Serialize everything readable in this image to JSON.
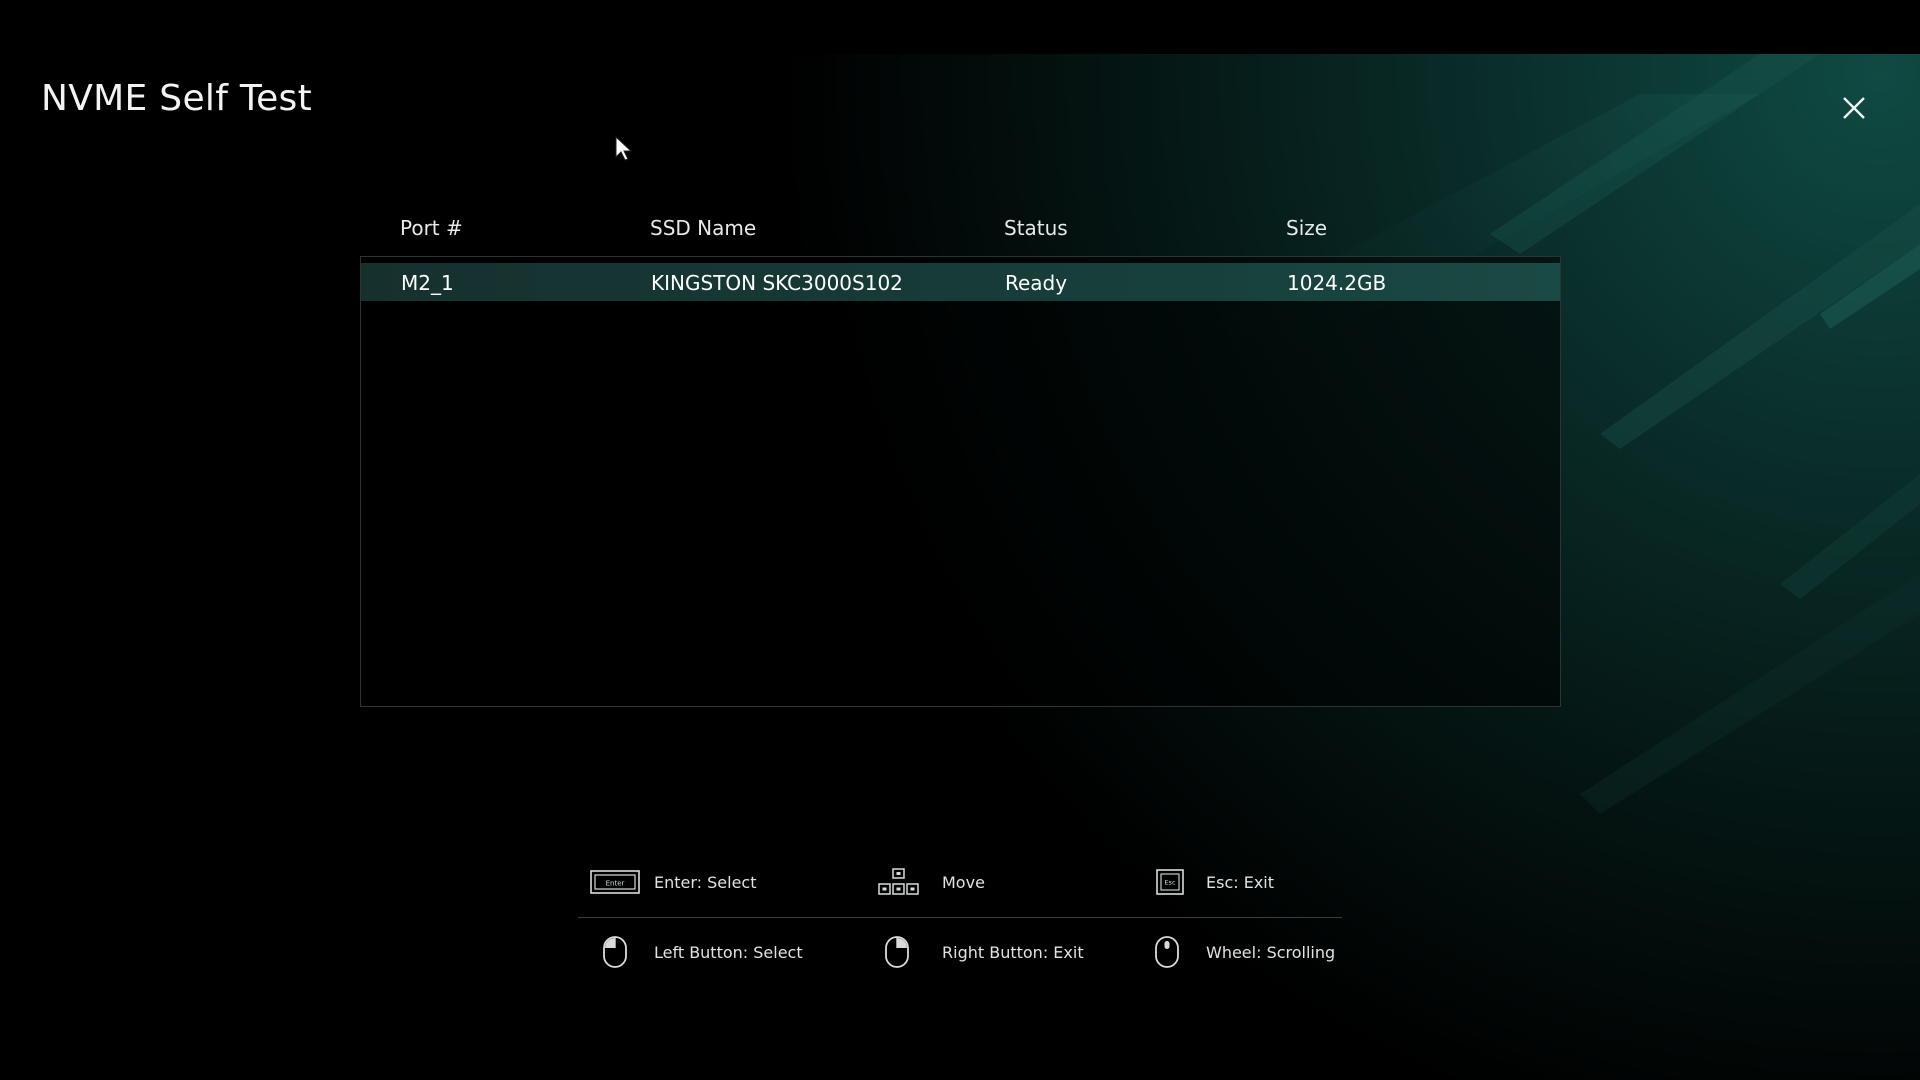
{
  "window": {
    "title": "NVME Self Test",
    "close_icon": "close-icon"
  },
  "table": {
    "columns": [
      "Port #",
      "SSD Name",
      "Status",
      "Size"
    ],
    "rows": [
      {
        "port": "M2_1",
        "name": "KINGSTON SKC3000S102",
        "status": "Ready",
        "size": "1024.2GB",
        "selected": true
      }
    ]
  },
  "hints": {
    "keyboard": [
      {
        "icon": "enter-key-icon",
        "label": "Enter: Select"
      },
      {
        "icon": "arrow-keys-icon",
        "label": "Move"
      },
      {
        "icon": "esc-key-icon",
        "label": "Esc: Exit"
      }
    ],
    "mouse": [
      {
        "icon": "mouse-left-button-icon",
        "label": "Left Button: Select"
      },
      {
        "icon": "mouse-right-button-icon",
        "label": "Right Button: Exit"
      },
      {
        "icon": "mouse-wheel-icon",
        "label": "Wheel: Scrolling"
      }
    ]
  },
  "colors": {
    "background": "#000000",
    "accent_teal": "#1a4a45",
    "text": "#e8ecec"
  }
}
